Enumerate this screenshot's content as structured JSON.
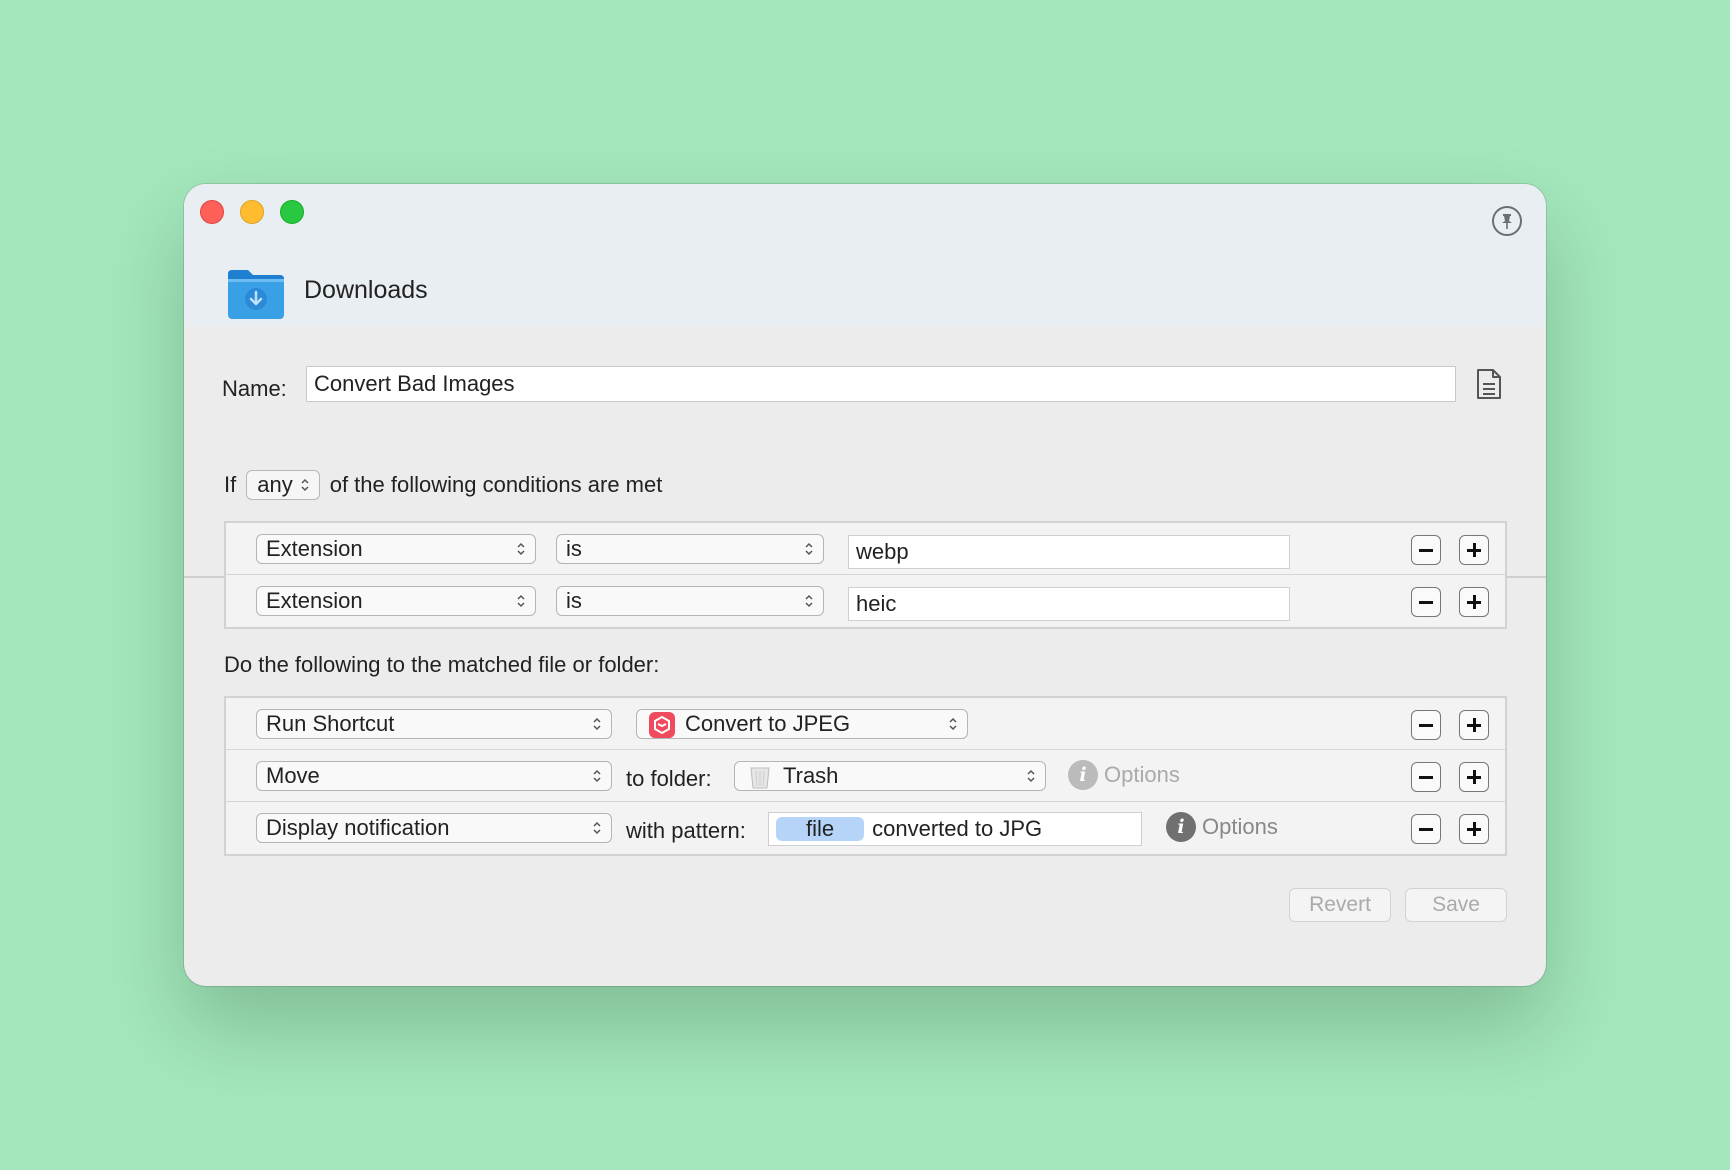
{
  "window": {
    "title": "Downloads"
  },
  "name": {
    "label": "Name:",
    "value": "Convert Bad Images"
  },
  "conditions": {
    "prefix": "If",
    "match_mode": "any",
    "suffix": "of the following conditions are met",
    "rows": [
      {
        "attribute": "Extension",
        "operator": "is",
        "value": "webp"
      },
      {
        "attribute": "Extension",
        "operator": "is",
        "value": "heic"
      }
    ]
  },
  "actions": {
    "heading": "Do the following to the matched file or folder:",
    "run_shortcut": {
      "action": "Run Shortcut",
      "shortcut": "Convert to JPEG"
    },
    "move": {
      "action": "Move",
      "label": "to folder:",
      "folder": "Trash",
      "options": "Options"
    },
    "notify": {
      "action": "Display notification",
      "label": "with pattern:",
      "token": "file",
      "text": "converted to JPG",
      "options": "Options"
    }
  },
  "footer": {
    "revert": "Revert",
    "save": "Save"
  },
  "icons": {
    "close": "close-icon",
    "minimize": "minimize-icon",
    "zoom": "zoom-icon",
    "pin": "pin-icon",
    "folder": "downloads-folder-icon",
    "document": "document-icon",
    "shortcut": "shortcuts-app-icon",
    "trash": "trash-icon",
    "info": "info-icon"
  },
  "colors": {
    "background": "#a4e7bc",
    "token": "#b5d4f8",
    "folder_blue": "#3aa0e6"
  }
}
